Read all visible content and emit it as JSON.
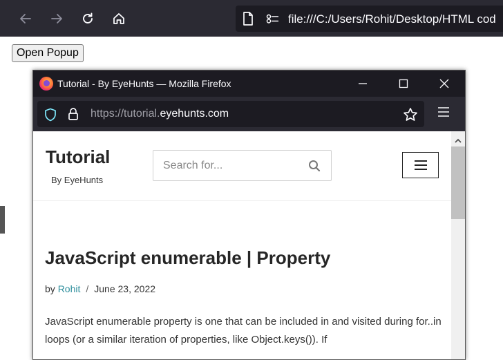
{
  "outer_browser": {
    "url": "file:///C:/Users/Rohit/Desktop/HTML cod",
    "icons": [
      "back-icon",
      "forward-icon",
      "reload-icon",
      "home-icon",
      "page-icon",
      "permissions-icon"
    ]
  },
  "page": {
    "open_popup_label": "Open Popup"
  },
  "popup": {
    "window_title": "Tutorial - By EyeHunts — Mozilla Firefox",
    "url_prefix": "https://tutorial.",
    "url_domain": "eyehunts.com",
    "site": {
      "title": "Tutorial",
      "tagline": "By EyeHunts",
      "search_placeholder": "Search for...",
      "article_title": "JavaScript enumerable | Property",
      "by_label": "by",
      "author": "Rohit",
      "separator": "/",
      "date": "June 23, 2022",
      "body": "JavaScript enumerable property is one that can be included in and visited during for..in loops (or a similar iteration of properties, like Object.keys()). If"
    }
  },
  "colors": {
    "toolbar_dark": "#2b2a33",
    "urlbar_dark": "#1c1b22",
    "author_link": "#2f8f9d"
  }
}
